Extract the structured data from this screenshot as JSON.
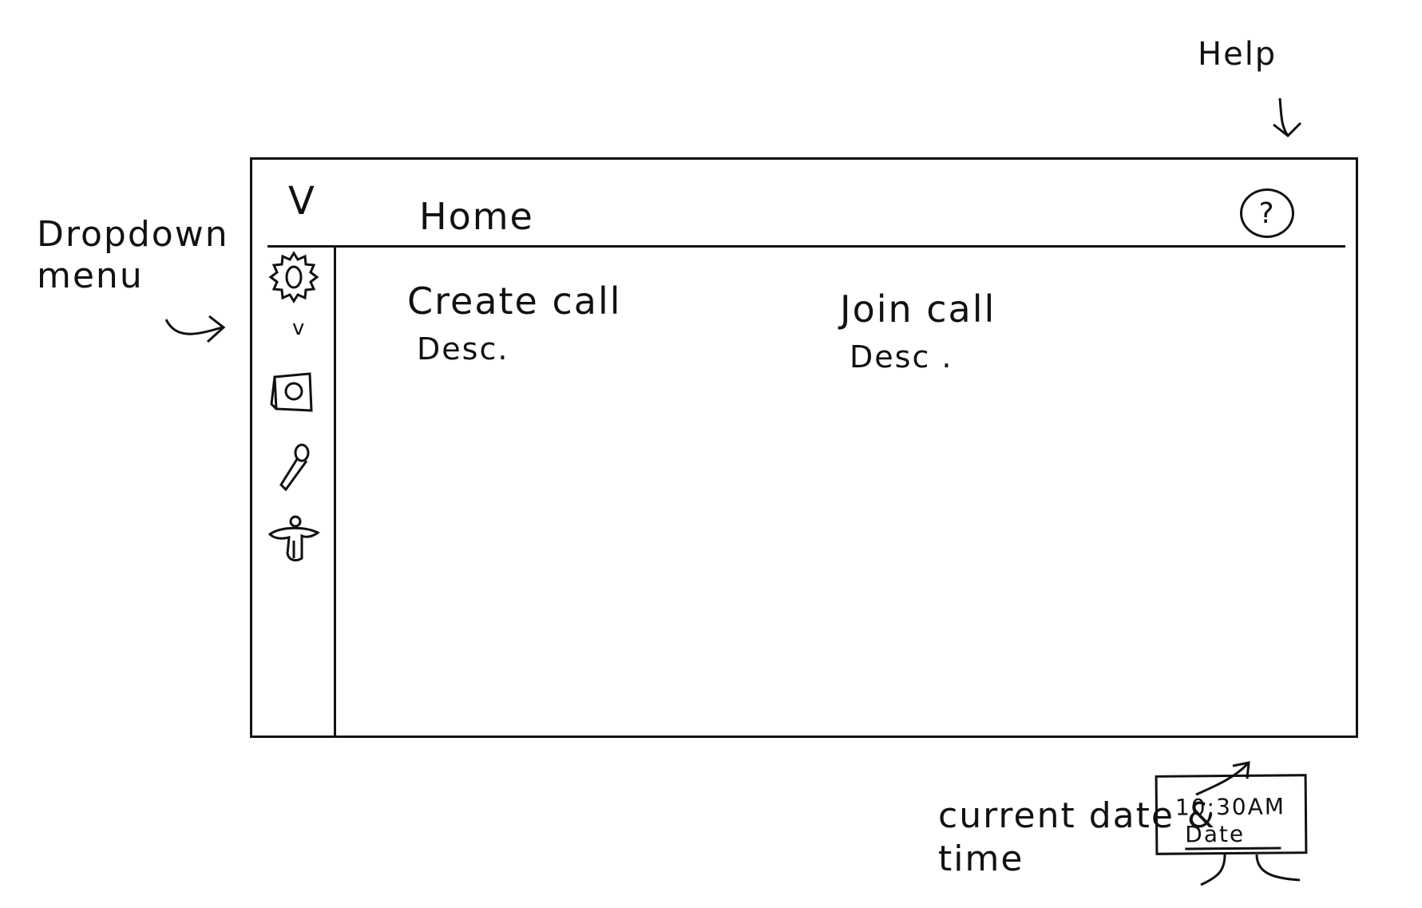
{
  "annotations": {
    "help": "Help",
    "dropdown_menu": "Dropdown menu",
    "current_date_time": "current date & time"
  },
  "header": {
    "menu_toggle": "V",
    "title": "Home",
    "help_button": "?"
  },
  "sidebar": {
    "caret": "v",
    "items": [
      {
        "icon": "gear-icon"
      },
      {
        "icon": "camera-icon"
      },
      {
        "icon": "microphone-icon"
      },
      {
        "icon": "accessibility-icon"
      }
    ]
  },
  "main": {
    "options": [
      {
        "title": "Create call",
        "desc": "Desc."
      },
      {
        "title": "Join call",
        "desc": "Desc ."
      }
    ]
  },
  "clock": {
    "time": "10:30AM",
    "date": "Date"
  }
}
